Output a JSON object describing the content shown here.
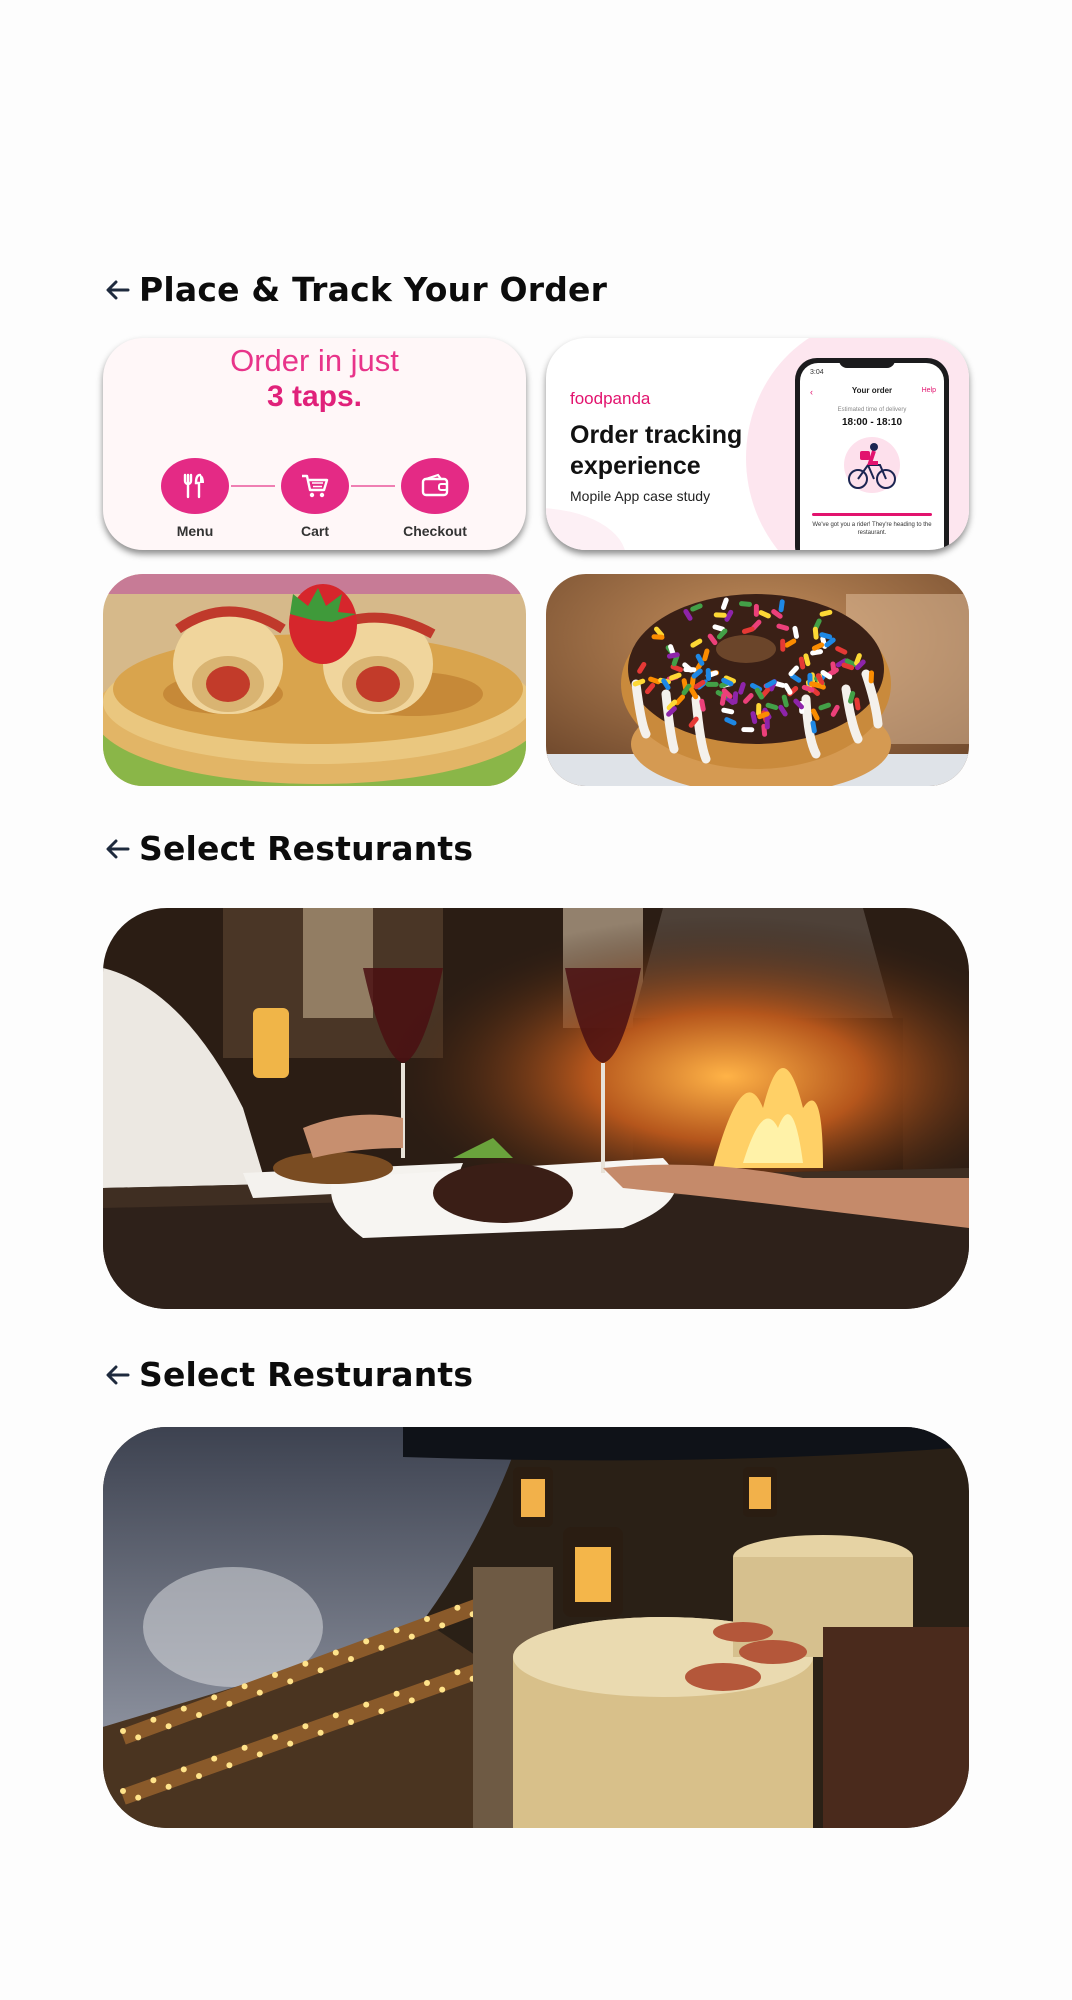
{
  "sections": [
    {
      "title": "Place & Track Your Order",
      "back_icon": "arrow-left-icon"
    },
    {
      "title": "Select Resturants",
      "back_icon": "arrow-left-icon"
    },
    {
      "title": "Select Resturants",
      "back_icon": "arrow-left-icon"
    }
  ],
  "order_card": {
    "line1": "Order in just",
    "line2": "3 taps.",
    "steps": [
      {
        "label": "Menu",
        "icon": "utensils-icon"
      },
      {
        "label": "Cart",
        "icon": "cart-icon"
      },
      {
        "label": "Checkout",
        "icon": "wallet-icon"
      }
    ],
    "accent": "#e42a85"
  },
  "tracking_card": {
    "brand": "foodpanda",
    "headline": "Order tracking experience",
    "subtitle": "Mopile App case study",
    "phone": {
      "status_time": "3:04",
      "screen_title": "Your order",
      "help": "Help",
      "eta_label": "Estimated time of delivery",
      "eta": "18:00 - 18:10",
      "message": "We've got you a rider! They're heading to the restaurant."
    },
    "accent": "#e2136e"
  },
  "images": [
    {
      "name": "pancakes-strawberry-photo"
    },
    {
      "name": "sprinkle-donut-photo"
    },
    {
      "name": "fireside-dinner-photo"
    },
    {
      "name": "beach-night-dining-photo"
    }
  ]
}
